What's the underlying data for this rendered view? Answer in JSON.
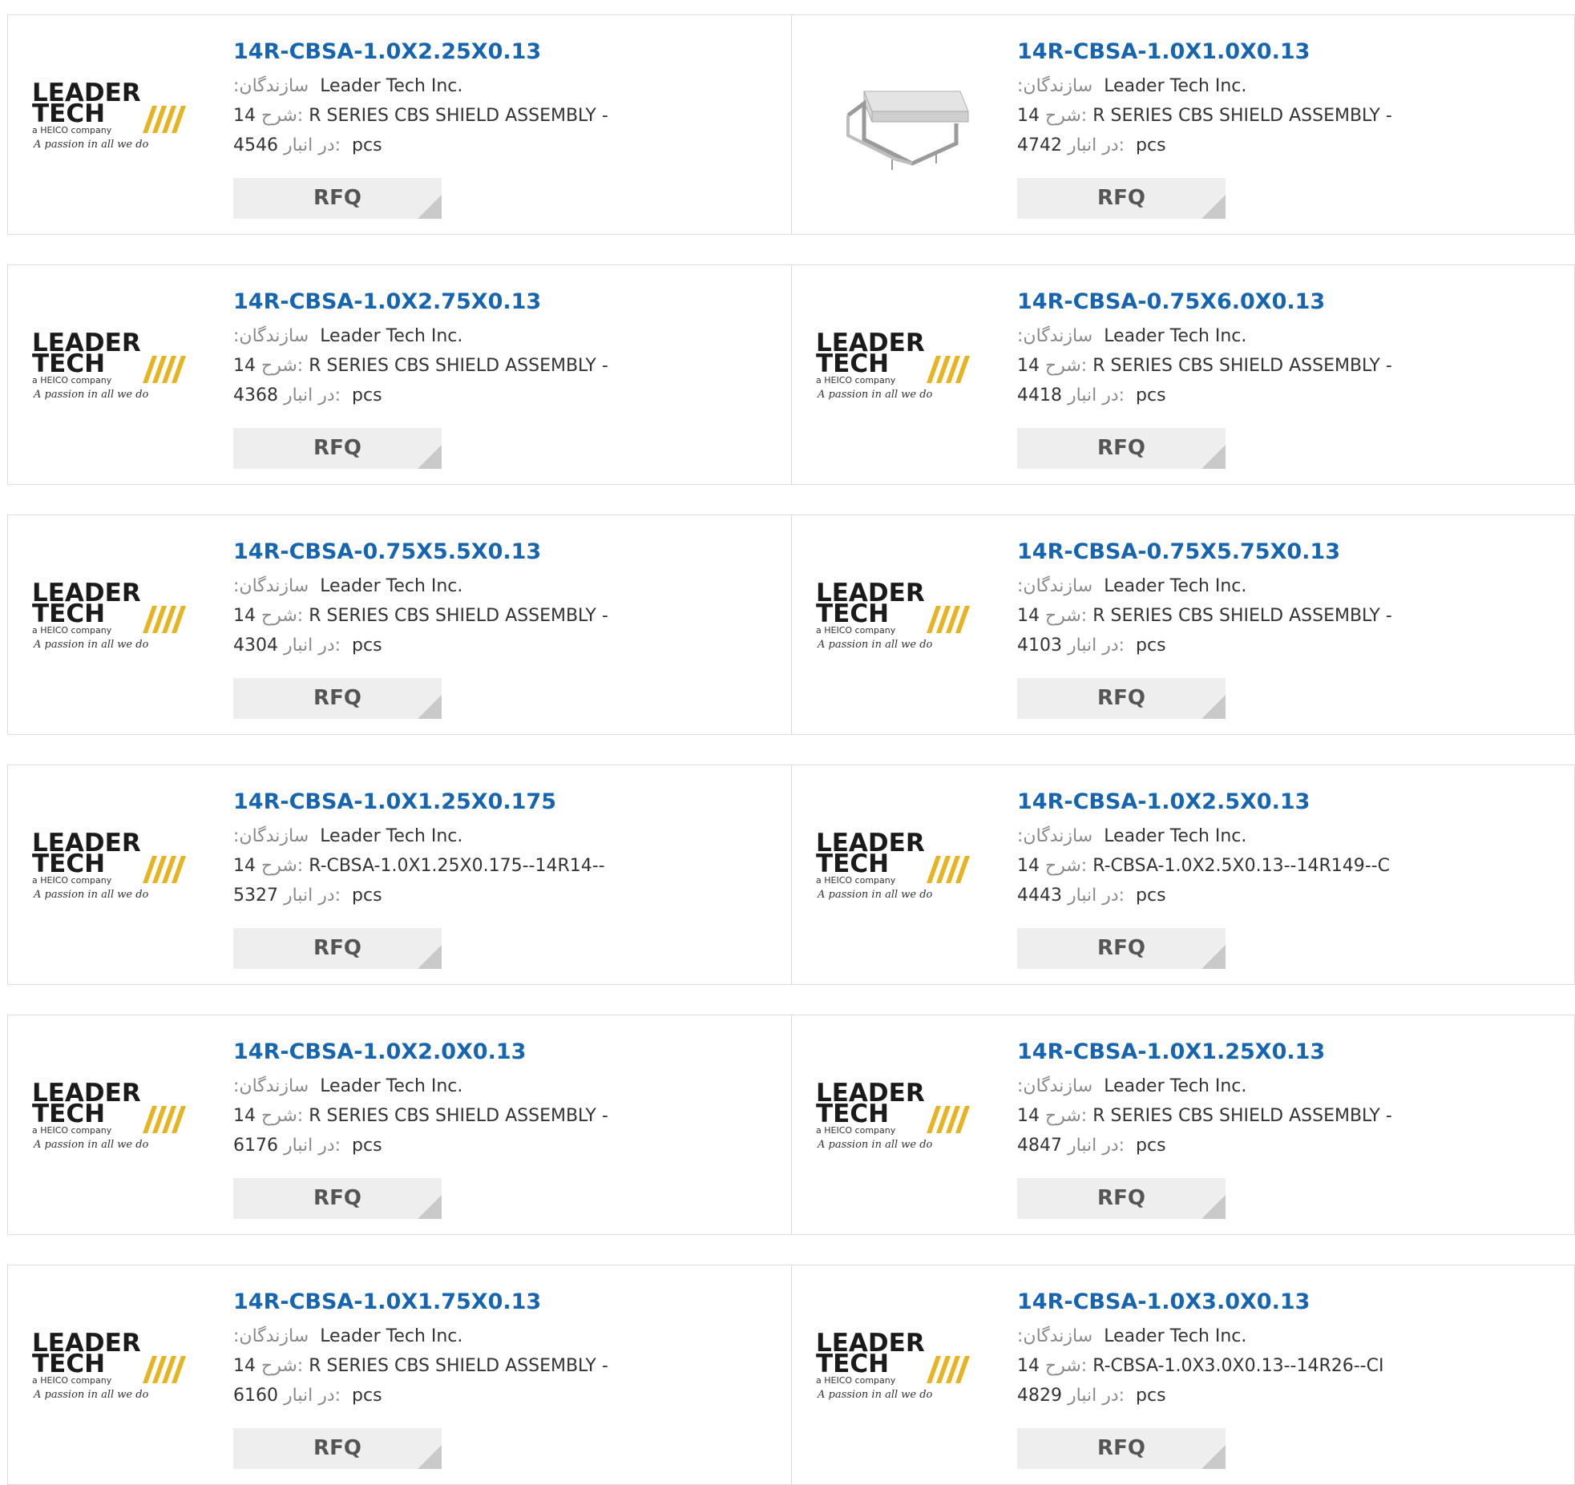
{
  "labels": {
    "manufacturer": ":سازندگان",
    "description": "شرح:",
    "stock": "در انبار:",
    "unit": "pcs",
    "rfq": "RFQ"
  },
  "logo": {
    "line1": "LEADER",
    "line2": "TECH",
    "tagline": "a HEICO company",
    "slogan": "A passion in all we do"
  },
  "colors": {
    "title": "#1565b0",
    "logo_yellow": "#e8b321",
    "button_bg": "#eeeeee"
  },
  "products": [
    {
      "title": "14R-CBSA-1.0X2.25X0.13",
      "image": "leader-tech-logo",
      "manufacturer": "Leader Tech Inc.",
      "desc_num": "14",
      "desc_text": "R SERIES CBS SHIELD ASSEMBLY -",
      "stock": "4546"
    },
    {
      "title": "14R-CBSA-1.0X1.0X0.13",
      "image": "shield-assembly-photo",
      "manufacturer": "Leader Tech Inc.",
      "desc_num": "14",
      "desc_text": "R SERIES CBS SHIELD ASSEMBLY -",
      "stock": "4742"
    },
    {
      "title": "14R-CBSA-1.0X2.75X0.13",
      "image": "leader-tech-logo",
      "manufacturer": "Leader Tech Inc.",
      "desc_num": "14",
      "desc_text": "R SERIES CBS SHIELD ASSEMBLY -",
      "stock": "4368"
    },
    {
      "title": "14R-CBSA-0.75X6.0X0.13",
      "image": "leader-tech-logo",
      "manufacturer": "Leader Tech Inc.",
      "desc_num": "14",
      "desc_text": "R SERIES CBS SHIELD ASSEMBLY -",
      "stock": "4418"
    },
    {
      "title": "14R-CBSA-0.75X5.5X0.13",
      "image": "leader-tech-logo",
      "manufacturer": "Leader Tech Inc.",
      "desc_num": "14",
      "desc_text": "R SERIES CBS SHIELD ASSEMBLY -",
      "stock": "4304"
    },
    {
      "title": "14R-CBSA-0.75X5.75X0.13",
      "image": "leader-tech-logo",
      "manufacturer": "Leader Tech Inc.",
      "desc_num": "14",
      "desc_text": "R SERIES CBS SHIELD ASSEMBLY -",
      "stock": "4103"
    },
    {
      "title": "14R-CBSA-1.0X1.25X0.175",
      "image": "leader-tech-logo",
      "manufacturer": "Leader Tech Inc.",
      "desc_num": "14",
      "desc_text": "R-CBSA-1.0X1.25X0.175--14R14--",
      "stock": "5327"
    },
    {
      "title": "14R-CBSA-1.0X2.5X0.13",
      "image": "leader-tech-logo",
      "manufacturer": "Leader Tech Inc.",
      "desc_num": "14",
      "desc_text": "R-CBSA-1.0X2.5X0.13--14R149--C",
      "stock": "4443"
    },
    {
      "title": "14R-CBSA-1.0X2.0X0.13",
      "image": "leader-tech-logo",
      "manufacturer": "Leader Tech Inc.",
      "desc_num": "14",
      "desc_text": "R SERIES CBS SHIELD ASSEMBLY -",
      "stock": "6176"
    },
    {
      "title": "14R-CBSA-1.0X1.25X0.13",
      "image": "leader-tech-logo",
      "manufacturer": "Leader Tech Inc.",
      "desc_num": "14",
      "desc_text": "R SERIES CBS SHIELD ASSEMBLY -",
      "stock": "4847"
    },
    {
      "title": "14R-CBSA-1.0X1.75X0.13",
      "image": "leader-tech-logo",
      "manufacturer": "Leader Tech Inc.",
      "desc_num": "14",
      "desc_text": "R SERIES CBS SHIELD ASSEMBLY -",
      "stock": "6160"
    },
    {
      "title": "14R-CBSA-1.0X3.0X0.13",
      "image": "leader-tech-logo",
      "manufacturer": "Leader Tech Inc.",
      "desc_num": "14",
      "desc_text": "R-CBSA-1.0X3.0X0.13--14R26--CI",
      "stock": "4829"
    }
  ]
}
